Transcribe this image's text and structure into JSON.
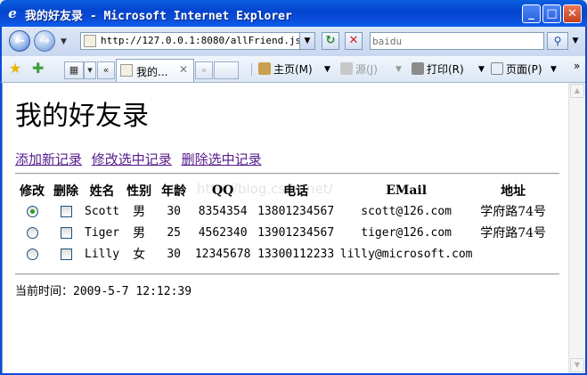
{
  "window": {
    "title": "我的好友录 - Microsoft Internet Explorer",
    "minimize_label": "_",
    "maximize_label": "□",
    "close_label": "✕"
  },
  "address_bar": {
    "back_label": "←",
    "forward_label": "→",
    "url": "http://127.0.0.1:8080/allFriend.jsp",
    "refresh_label": "↻",
    "stop_label": "✕",
    "search_placeholder": "baidu",
    "search_icon": "search-icon"
  },
  "command_bar": {
    "active_tab_label": "我的...",
    "tab_close_label": "✕",
    "scroll_left_label": "«",
    "scroll_right_label": "»",
    "home_label": "主页(M)",
    "feeds_label": "源(J)",
    "print_label": "打印(R)",
    "page_label": "页面(P)",
    "more_label": "»"
  },
  "page": {
    "heading": "我的好友录",
    "links": {
      "add": "添加新记录",
      "edit": "修改选中记录",
      "delete": "删除选中记录"
    },
    "watermark": "http://blog.csdn.net/",
    "table": {
      "headers": [
        "修改",
        "删除",
        "姓名",
        "性别",
        "年龄",
        "QQ",
        "电话",
        "EMail",
        "地址"
      ],
      "rows": [
        {
          "selected": true,
          "name": "Scott",
          "gender": "男",
          "age": "30",
          "qq": "8354354",
          "phone": "13801234567",
          "email": "scott@126.com",
          "address": "学府路74号"
        },
        {
          "selected": false,
          "name": "Tiger",
          "gender": "男",
          "age": "25",
          "qq": "4562340",
          "phone": "13901234567",
          "email": "tiger@126.com",
          "address": "学府路74号"
        },
        {
          "selected": false,
          "name": "Lilly",
          "gender": "女",
          "age": "30",
          "qq": "12345678",
          "phone": "13300112233",
          "email": "lilly@microsoft.com",
          "address": ""
        }
      ]
    },
    "current_time_label": "当前时间：",
    "current_time_value": "2009-5-7 12:12:39"
  },
  "colors": {
    "titlebar": "#0A4CD8",
    "link_visited": "#551A8B",
    "radio_checked": "#21A121"
  }
}
